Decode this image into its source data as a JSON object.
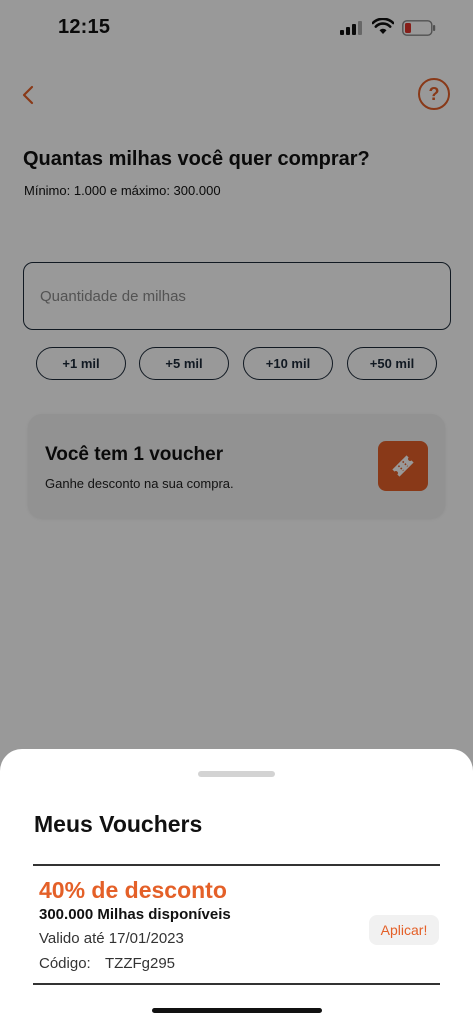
{
  "status_bar": {
    "time": "12:15"
  },
  "colors": {
    "accent": "#e46028",
    "dark": "#1d2b3a",
    "overlay": "rgba(0,0,0,0.4)"
  },
  "header": {
    "back_icon": "chevron-left-icon",
    "help_label": "?"
  },
  "main": {
    "title": "Quantas milhas você quer comprar?",
    "subtitle": "Mínimo: 1.000 e máximo: 300.000",
    "quantity_input": {
      "placeholder": "Quantidade de milhas",
      "value": ""
    },
    "chips": [
      {
        "label": "+1 mil"
      },
      {
        "label": "+5 mil"
      },
      {
        "label": "+10 mil"
      },
      {
        "label": "+50 mil"
      }
    ],
    "voucher_card": {
      "title": "Você tem 1 voucher",
      "subtitle": "Ganhe desconto na sua compra.",
      "icon": "ticket-icon"
    }
  },
  "sheet": {
    "title": "Meus Vouchers",
    "voucher": {
      "discount": "40% de desconto",
      "miles": "300.000 Milhas disponíveis",
      "valid": "Valido até 17/01/2023",
      "code_label": "Código:",
      "code_value": "TZZFg295",
      "apply_label": "Aplicar!"
    }
  }
}
